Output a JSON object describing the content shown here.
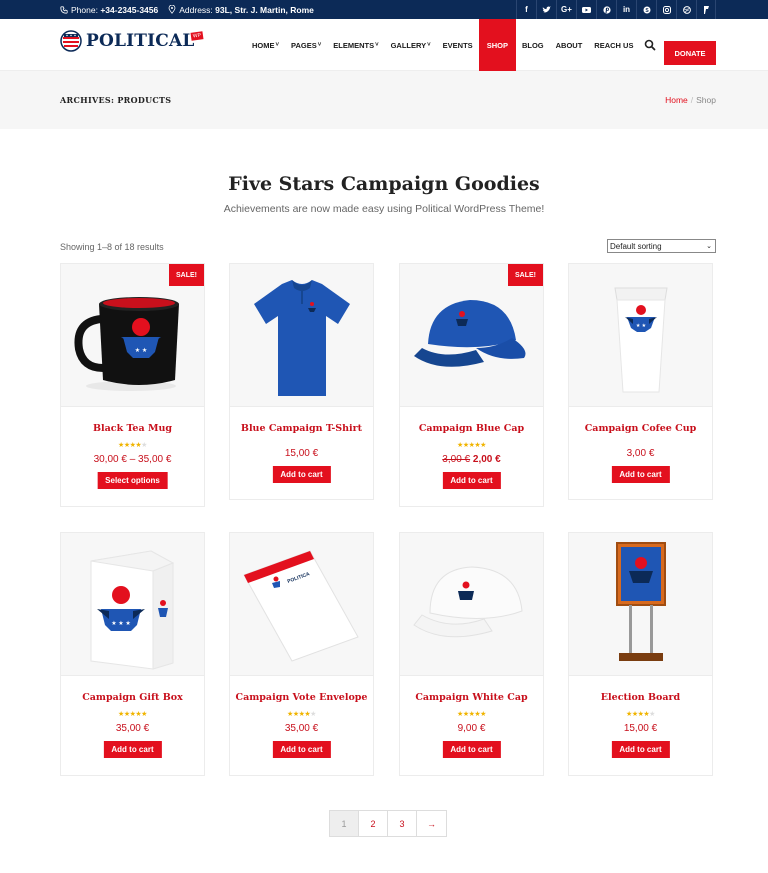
{
  "topbar": {
    "phone_label": "Phone:",
    "phone": "+34-2345-3456",
    "address_label": "Address:",
    "address": "93L, Str. J. Martin, Rome",
    "socials": [
      "f",
      "t",
      "G+",
      "yt",
      "p",
      "in",
      "S",
      "ig",
      "dr",
      "4s"
    ]
  },
  "header": {
    "logo_text": "POLITICAL",
    "logo_badge": "WP",
    "nav": [
      {
        "label": "HOME",
        "dropdown": true,
        "active": false
      },
      {
        "label": "PAGES",
        "dropdown": true,
        "active": false
      },
      {
        "label": "ELEMENTS",
        "dropdown": true,
        "active": false
      },
      {
        "label": "GALLERY",
        "dropdown": true,
        "active": false
      },
      {
        "label": "EVENTS",
        "dropdown": false,
        "active": false
      },
      {
        "label": "SHOP",
        "dropdown": false,
        "active": true
      },
      {
        "label": "BLOG",
        "dropdown": false,
        "active": false
      },
      {
        "label": "ABOUT",
        "dropdown": false,
        "active": false
      },
      {
        "label": "REACH US",
        "dropdown": false,
        "active": false
      }
    ],
    "donate_label": "DONATE"
  },
  "pagebar": {
    "title": "ARCHIVES: PRODUCTS",
    "breadcrumb_home": "Home",
    "breadcrumb_sep": "/",
    "breadcrumb_current": "Shop"
  },
  "shop": {
    "title": "Five Stars Campaign Goodies",
    "subtitle": "Achievements are now made easy using Political WordPress Theme!",
    "result_count": "Showing 1–8 of 18 results",
    "sort_selected": "Default sorting",
    "products": [
      {
        "name": "Black Tea Mug",
        "sale": "SALE!",
        "stars": 4,
        "price": "30,00 € – 35,00 €",
        "old_price": "",
        "new_price": "",
        "button": "Select options",
        "image": "mug"
      },
      {
        "name": "Blue Campaign T-Shirt",
        "sale": "",
        "stars": 0,
        "price": "15,00 €",
        "old_price": "",
        "new_price": "",
        "button": "Add to cart",
        "image": "shirt"
      },
      {
        "name": "Campaign Blue Cap",
        "sale": "SALE!",
        "stars": 4.5,
        "price": "",
        "old_price": "3,00 €",
        "new_price": "2,00 €",
        "button": "Add to cart",
        "image": "bluecap"
      },
      {
        "name": "Campaign Cofee Cup",
        "sale": "",
        "stars": 0,
        "price": "3,00 €",
        "old_price": "",
        "new_price": "",
        "button": "Add to cart",
        "image": "cup"
      },
      {
        "name": "Campaign Gift Box",
        "sale": "",
        "stars": 5,
        "price": "35,00 €",
        "old_price": "",
        "new_price": "",
        "button": "Add to cart",
        "image": "box"
      },
      {
        "name": "Campaign Vote Envelope",
        "sale": "",
        "stars": 4,
        "price": "35,00 €",
        "old_price": "",
        "new_price": "",
        "button": "Add to cart",
        "image": "envelope"
      },
      {
        "name": "Campaign White Cap",
        "sale": "",
        "stars": 5,
        "price": "9,00 €",
        "old_price": "",
        "new_price": "",
        "button": "Add to cart",
        "image": "whitecap"
      },
      {
        "name": "Election Board",
        "sale": "",
        "stars": 4,
        "price": "15,00 €",
        "old_price": "",
        "new_price": "",
        "button": "Add to cart",
        "image": "board"
      }
    ],
    "pagination": [
      "1",
      "2",
      "3",
      "→"
    ],
    "current_page": "1"
  },
  "colors": {
    "accent": "#e3101e",
    "navy": "#0c2a57",
    "star": "#f0b400"
  }
}
